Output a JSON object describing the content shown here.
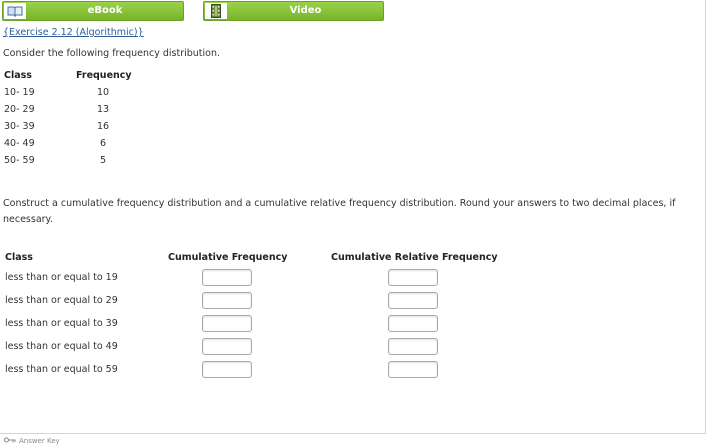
{
  "buttons": {
    "ebook": {
      "label": "eBook",
      "icon": "book-icon"
    },
    "video": {
      "label": "Video",
      "icon": "film-icon"
    }
  },
  "exercise_link": "{Exercise 2.12 (Algorithmic)}",
  "intro": "Consider the following frequency distribution.",
  "frequency_table": {
    "headers": [
      "Class",
      "Frequency"
    ],
    "rows": [
      {
        "class": "10- 19",
        "frequency": "10"
      },
      {
        "class": "20- 29",
        "frequency": "13"
      },
      {
        "class": "30- 39",
        "frequency": "16"
      },
      {
        "class": "40- 49",
        "frequency": "6"
      },
      {
        "class": "50- 59",
        "frequency": "5"
      }
    ]
  },
  "instructions": "Construct a cumulative frequency distribution and a cumulative relative frequency distribution. Round your answers to two decimal places, if necessary.",
  "cumulative_table": {
    "headers": [
      "Class",
      "Cumulative Frequency",
      "Cumulative Relative Frequency"
    ],
    "rows": [
      {
        "label": "less than or equal to 19",
        "cum_freq": "",
        "cum_rel_freq": ""
      },
      {
        "label": "less than or equal to 29",
        "cum_freq": "",
        "cum_rel_freq": ""
      },
      {
        "label": "less than or equal to 39",
        "cum_freq": "",
        "cum_rel_freq": ""
      },
      {
        "label": "less than or equal to 49",
        "cum_freq": "",
        "cum_rel_freq": ""
      },
      {
        "label": "less than or equal to 59",
        "cum_freq": "",
        "cum_rel_freq": ""
      }
    ]
  },
  "answer_key_label": "Answer Key",
  "colors": {
    "button_green": "#86c33a",
    "link_blue": "#2f5d9a",
    "border_gray": "#a9a9a9"
  }
}
